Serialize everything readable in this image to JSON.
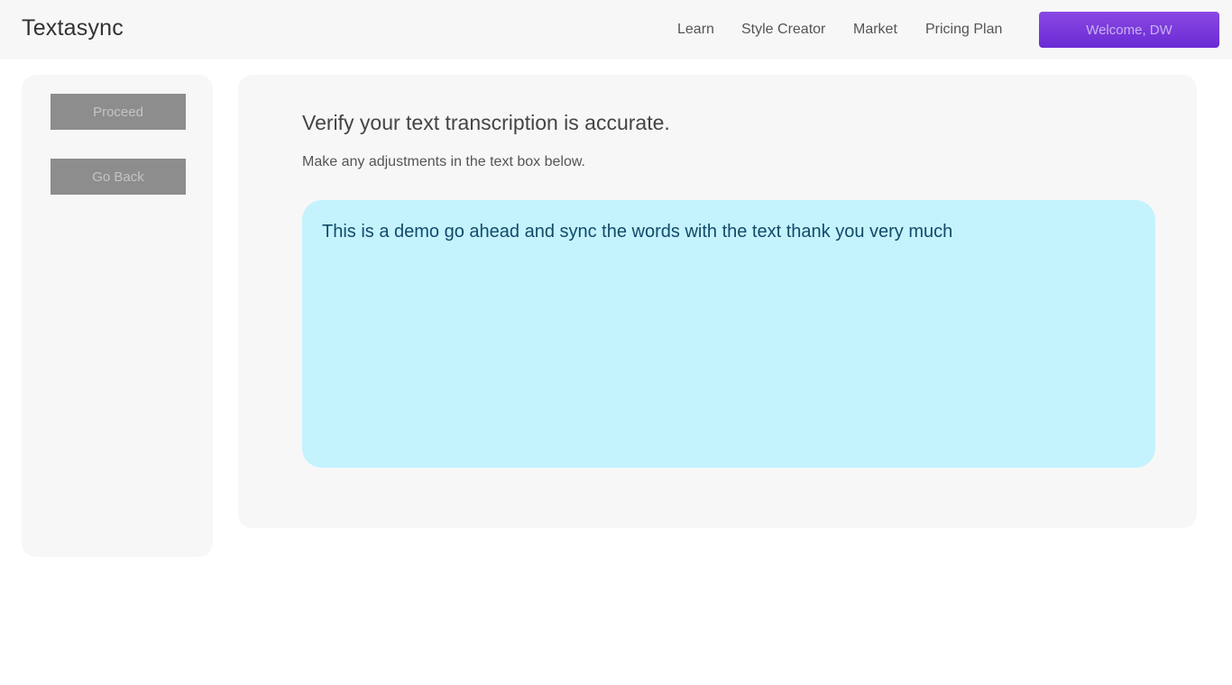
{
  "header": {
    "brand": "Textasync",
    "nav": [
      {
        "label": "Learn"
      },
      {
        "label": "Style Creator"
      },
      {
        "label": "Market"
      },
      {
        "label": "Pricing Plan"
      }
    ],
    "welcome_label": "Welcome, DW"
  },
  "sidebar": {
    "proceed_label": "Proceed",
    "go_back_label": "Go Back"
  },
  "main": {
    "title": "Verify your text transcription is accurate.",
    "subtitle": "Make any adjustments in the text box below.",
    "transcript_text": "This is a demo go ahead and sync the words with the text thank you very much"
  },
  "colors": {
    "accent": "#7a3ae0",
    "transcript_bg": "#c4f3fd",
    "button_gray": "#8d8d8d",
    "panel_bg": "#f7f7f7"
  }
}
